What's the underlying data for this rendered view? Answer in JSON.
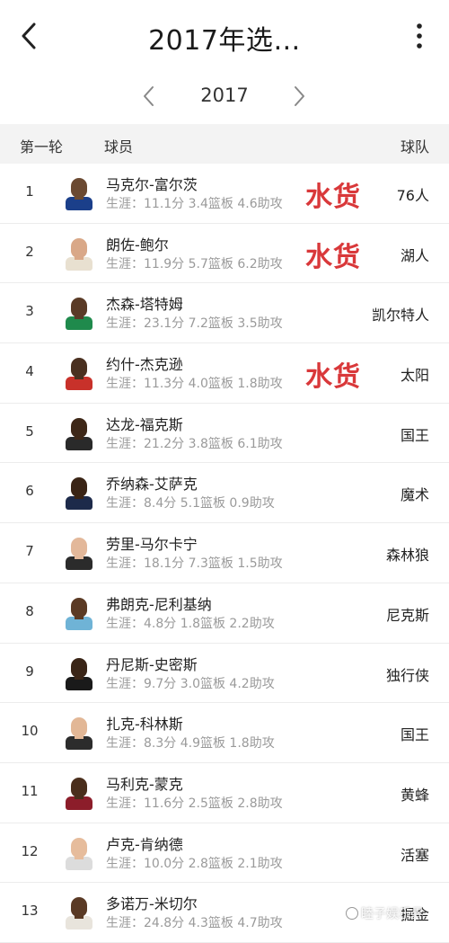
{
  "header": {
    "title": "2017年选…",
    "back_icon": "chevron-left-icon",
    "more_icon": "more-vertical-icon"
  },
  "year_selector": {
    "year": "2017",
    "prev_icon": "chevron-left-icon",
    "next_icon": "chevron-right-icon"
  },
  "table": {
    "col_round": "第一轮",
    "col_player": "球员",
    "col_team": "球队"
  },
  "players": [
    {
      "pick": "1",
      "name": "马克尔-富尔茨",
      "stats": "生涯：11.1分 3.4篮板 4.6助攻",
      "team": "76人",
      "note": "水货",
      "skin": "#6b4a32",
      "jersey": "#1b3f8a"
    },
    {
      "pick": "2",
      "name": "朗佐-鲍尔",
      "stats": "生涯：11.9分 5.7篮板 6.2助攻",
      "team": "湖人",
      "note": "水货",
      "skin": "#d9a888",
      "jersey": "#e8e0d0"
    },
    {
      "pick": "3",
      "name": "杰森-塔特姆",
      "stats": "生涯：23.1分 7.2篮板 3.5助攻",
      "team": "凯尔特人",
      "note": "",
      "skin": "#5a3b26",
      "jersey": "#1f8a4c"
    },
    {
      "pick": "4",
      "name": "约什-杰克逊",
      "stats": "生涯：11.3分 4.0篮板 1.8助攻",
      "team": "太阳",
      "note": "水货",
      "skin": "#4a3020",
      "jersey": "#c8312a"
    },
    {
      "pick": "5",
      "name": "达龙-福克斯",
      "stats": "生涯：21.2分 3.8篮板 6.1助攻",
      "team": "国王",
      "note": "",
      "skin": "#3e2818",
      "jersey": "#2a2a2a"
    },
    {
      "pick": "6",
      "name": "乔纳森-艾萨克",
      "stats": "生涯：8.4分 5.1篮板 0.9助攻",
      "team": "魔术",
      "note": "",
      "skin": "#3a2415",
      "jersey": "#1d2a4a"
    },
    {
      "pick": "7",
      "name": "劳里-马尔卡宁",
      "stats": "生涯：18.1分 7.3篮板 1.5助攻",
      "team": "森林狼",
      "note": "",
      "skin": "#e3b89a",
      "jersey": "#2b2b2b"
    },
    {
      "pick": "8",
      "name": "弗朗克-尼利基纳",
      "stats": "生涯：4.8分 1.8篮板 2.2助攻",
      "team": "尼克斯",
      "note": "",
      "skin": "#5b3a24",
      "jersey": "#6fb3d6"
    },
    {
      "pick": "9",
      "name": "丹尼斯-史密斯",
      "stats": "生涯：9.7分 3.0篮板 4.2助攻",
      "team": "独行侠",
      "note": "",
      "skin": "#3a2517",
      "jersey": "#1a1a1a"
    },
    {
      "pick": "10",
      "name": "扎克-科林斯",
      "stats": "生涯：8.3分 4.9篮板 1.8助攻",
      "team": "国王",
      "note": "",
      "skin": "#e2b796",
      "jersey": "#2c2c2c"
    },
    {
      "pick": "11",
      "name": "马利克-蒙克",
      "stats": "生涯：11.6分 2.5篮板 2.8助攻",
      "team": "黄蜂",
      "note": "",
      "skin": "#4a2e1c",
      "jersey": "#8c1d2a"
    },
    {
      "pick": "12",
      "name": "卢克-肯纳德",
      "stats": "生涯：10.0分 2.8篮板 2.1助攻",
      "team": "活塞",
      "note": "",
      "skin": "#e6bc9c",
      "jersey": "#dcdcdc"
    },
    {
      "pick": "13",
      "name": "多诺万-米切尔",
      "stats": "生涯：24.8分 4.3篮板 4.7助攻",
      "team": "掘金",
      "note": "",
      "skin": "#5a3a25",
      "jersey": "#e8e4dc"
    }
  ],
  "watermark": "睦子娱乐界"
}
